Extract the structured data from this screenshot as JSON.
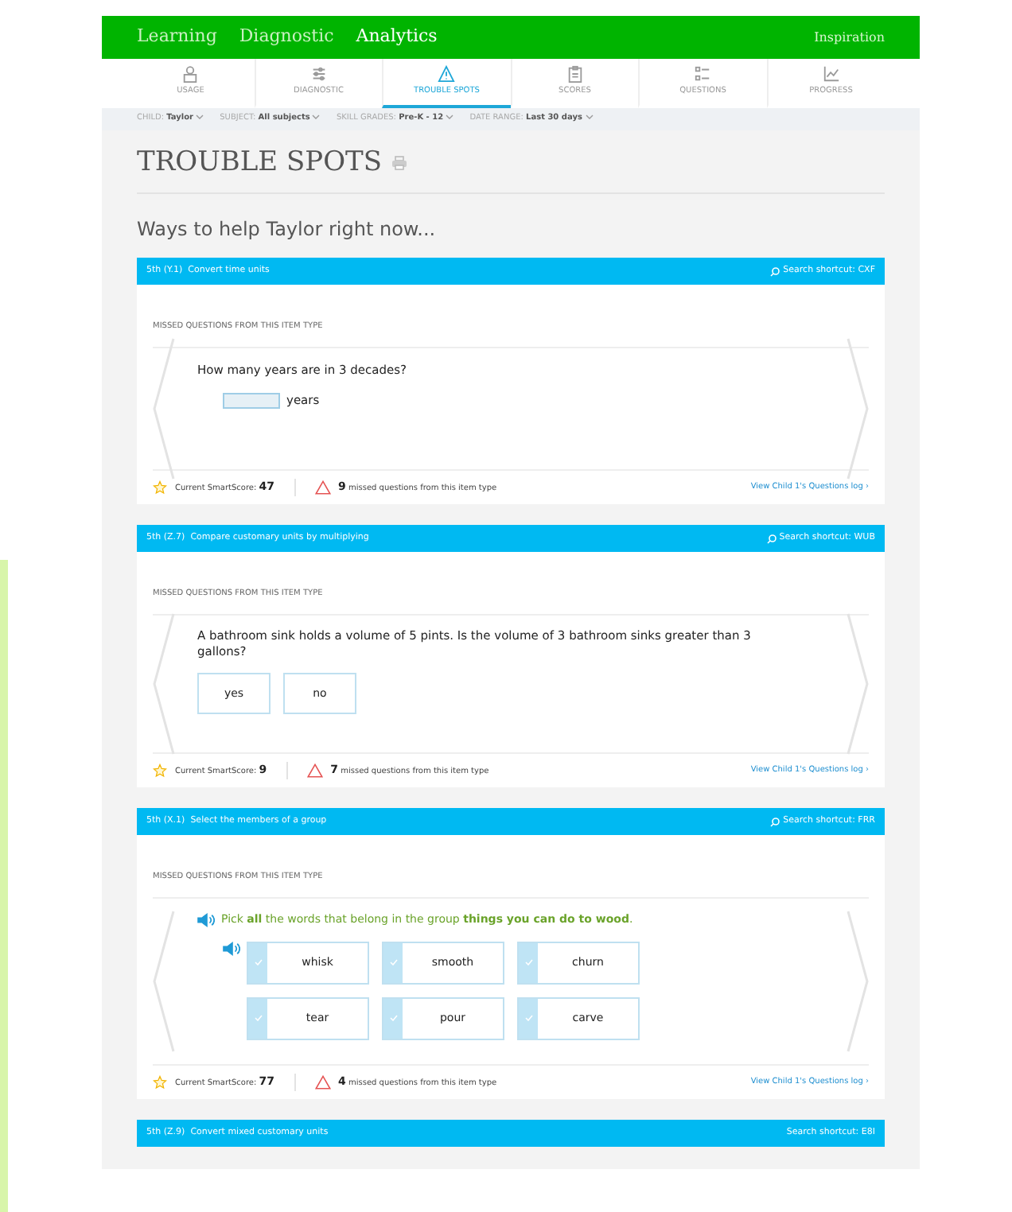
{
  "top_nav": {
    "items": [
      {
        "label": "Learning",
        "selected": false
      },
      {
        "label": "Diagnostic",
        "selected": false
      },
      {
        "label": "Analytics",
        "selected": true
      }
    ],
    "right_link": "Inspiration"
  },
  "tabs": [
    {
      "label": "USAGE",
      "selected": false
    },
    {
      "label": "DIAGNOSTIC",
      "selected": false
    },
    {
      "label": "TROUBLE SPOTS",
      "selected": true
    },
    {
      "label": "SCORES",
      "selected": false
    },
    {
      "label": "QUESTIONS",
      "selected": false
    },
    {
      "label": "PROGRESS",
      "selected": false
    }
  ],
  "filters": [
    {
      "label": "CHILD:",
      "value": "Taylor"
    },
    {
      "label": "SUBJECT:",
      "value": "All subjects"
    },
    {
      "label": "SKILL GRADES:",
      "value": "Pre-K - 12"
    },
    {
      "label": "DATE RANGE:",
      "value": "Last 30 days"
    }
  ],
  "page_title": "TROUBLE SPOTS",
  "subtitle": "Ways to help Taylor right now...",
  "cards": [
    {
      "skill": "5th (Y.1)  Convert time units",
      "shortcut": "Search shortcut: CXF",
      "section_label": "MISSED QUESTIONS FROM THIS ITEM TYPE",
      "question": {
        "kind": "input",
        "prompt": "How many years are in 3 decades?",
        "unit": "years"
      },
      "score_label": "Current SmartScore:",
      "score": "47",
      "missed_count": "9",
      "missed_text": "missed questions from this item type",
      "log_link": "View Child 1's Questions log ›"
    },
    {
      "skill": "5th (Z.7)  Compare customary units by multiplying",
      "shortcut": "Search shortcut: WUB",
      "section_label": "MISSED QUESTIONS FROM THIS ITEM TYPE",
      "question": {
        "kind": "choice",
        "prompt": "A bathroom sink holds a volume of 5 pints. Is the volume of 3 bathroom sinks greater than 3 gallons?",
        "options": [
          "yes",
          "no"
        ]
      },
      "score_label": "Current SmartScore:",
      "score": "9",
      "missed_count": "7",
      "missed_text": "missed questions from this item type",
      "log_link": "View Child 1's Questions log ›"
    },
    {
      "skill": "5th (X.1)  Select the members of a group",
      "shortcut": "Search shortcut: FRR",
      "section_label": "MISSED QUESTIONS FROM THIS ITEM TYPE",
      "question": {
        "kind": "multi",
        "prompt": "Pick **all** the words that belong in the group **things you can do to wood**.",
        "options": [
          "whisk",
          "smooth",
          "churn",
          "tear",
          "pour",
          "carve"
        ]
      },
      "score_label": "Current SmartScore:",
      "score": "77",
      "missed_count": "4",
      "missed_text": "missed questions from this item type",
      "log_link": "View Child 1's Questions log ›"
    }
  ],
  "partial_card": {
    "skill": "5th (Z.9)  Convert mixed customary units",
    "shortcut": "Search shortcut: E8I"
  }
}
